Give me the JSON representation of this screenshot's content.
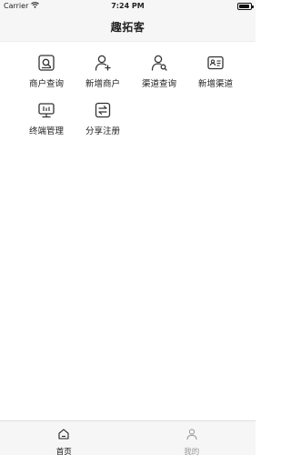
{
  "status_bar": {
    "carrier": "Carrier",
    "time": "7:24 PM"
  },
  "nav": {
    "title": "趣拓客"
  },
  "menu": [
    {
      "label": "商户查询",
      "icon": "merchant-search-icon"
    },
    {
      "label": "新增商户",
      "icon": "add-user-icon"
    },
    {
      "label": "渠道查询",
      "icon": "channel-search-icon"
    },
    {
      "label": "新增渠道",
      "icon": "id-card-icon"
    },
    {
      "label": "终端管理",
      "icon": "terminal-icon"
    },
    {
      "label": "分享注册",
      "icon": "share-register-icon"
    }
  ],
  "tabs": [
    {
      "label": "首页",
      "icon": "home-icon",
      "active": true
    },
    {
      "label": "我的",
      "icon": "profile-icon",
      "active": false
    }
  ]
}
